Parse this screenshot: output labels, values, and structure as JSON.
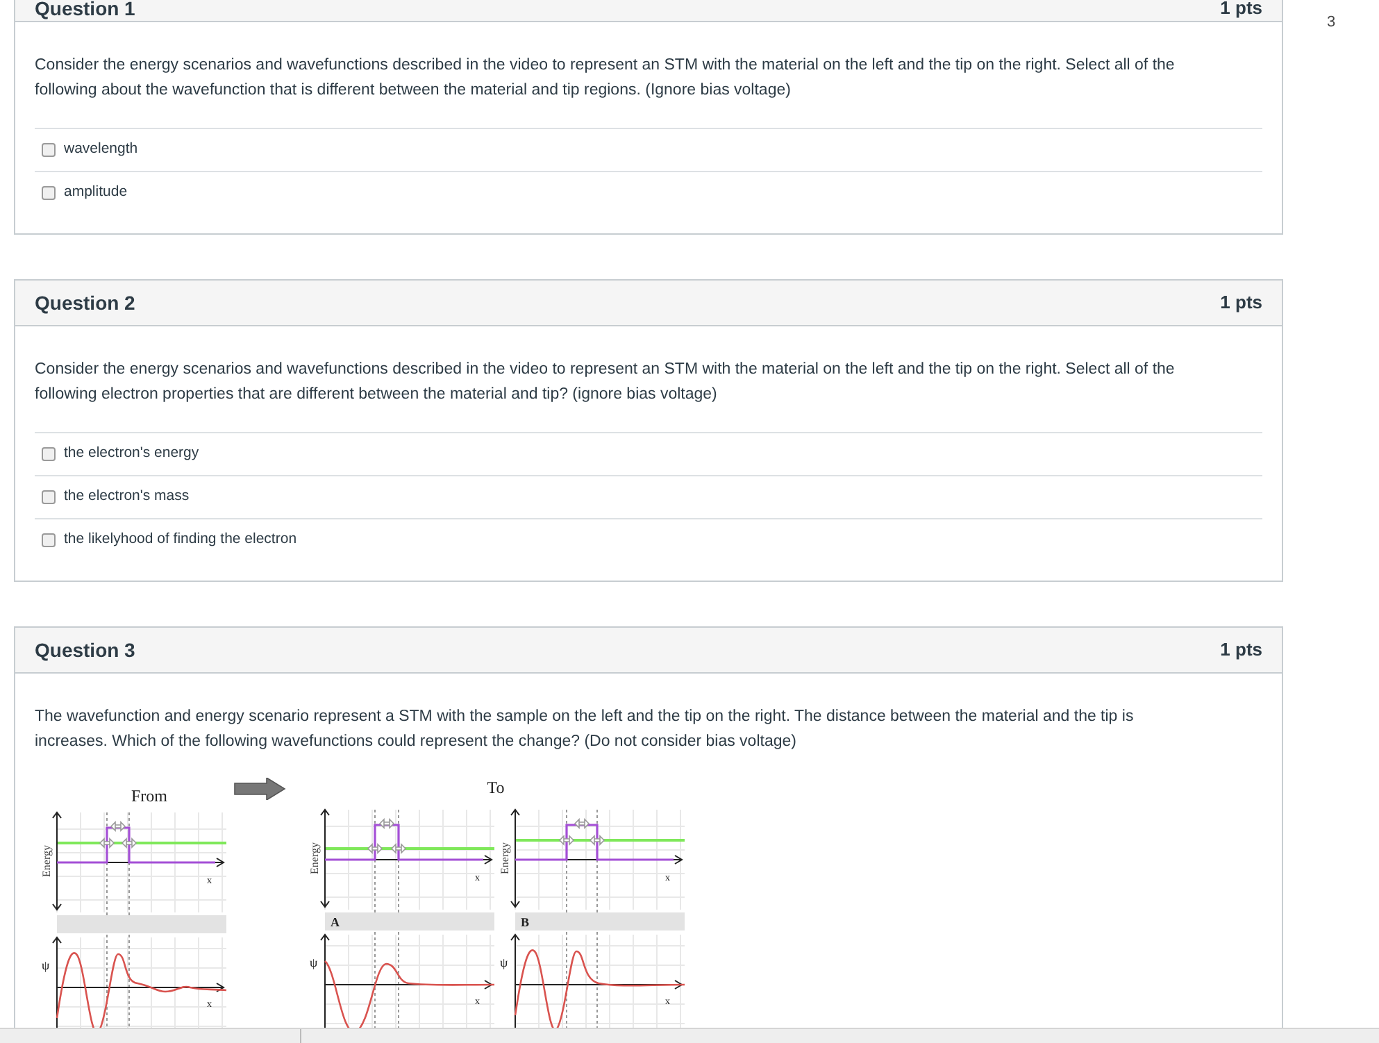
{
  "side_column": {
    "text": "3"
  },
  "questions": [
    {
      "title": "Question 1",
      "points": "1 pts",
      "prompt": "Consider the energy scenarios and wavefunctions described in the video to represent an STM with the material on the left and the tip on the right. Select all of the following about the wavefunction that is different between the material and tip regions. (Ignore bias voltage)",
      "options": [
        {
          "label": "wavelength",
          "checked": false
        },
        {
          "label": "amplitude",
          "checked": false
        }
      ]
    },
    {
      "title": "Question 2",
      "points": "1 pts",
      "prompt": "Consider the energy scenarios and wavefunctions described in the video to represent an STM with the material on the left and the tip on the right. Select all of the following electron properties that are different between the material and tip? (ignore bias voltage)",
      "options": [
        {
          "label": "the electron's energy",
          "checked": false
        },
        {
          "label": "the electron's mass",
          "checked": false
        },
        {
          "label": "the likelyhood of finding the electron",
          "checked": false
        }
      ]
    },
    {
      "title": "Question 3",
      "points": "1 pts",
      "prompt": "The wavefunction and energy scenario represent a STM with the sample on the left and the tip on the right. The distance between the material and the tip is increases. Which of the following wavefunctions could represent the change? (Do not consider bias voltage)",
      "figure": {
        "from_label": "From",
        "to_label": "To",
        "panels": [
          {
            "energy_label": "Energy",
            "x_label_top": "x",
            "psi_label": "ψ",
            "x_label_bottom": "x"
          },
          {
            "tag": "A",
            "energy_label": "Energy",
            "x_label_top": "x",
            "psi_label": "ψ",
            "x_label_bottom": "x"
          },
          {
            "tag": "B",
            "energy_label": "Energy",
            "x_label_top": "x",
            "psi_label": "ψ",
            "x_label_bottom": "x"
          }
        ]
      }
    }
  ]
}
